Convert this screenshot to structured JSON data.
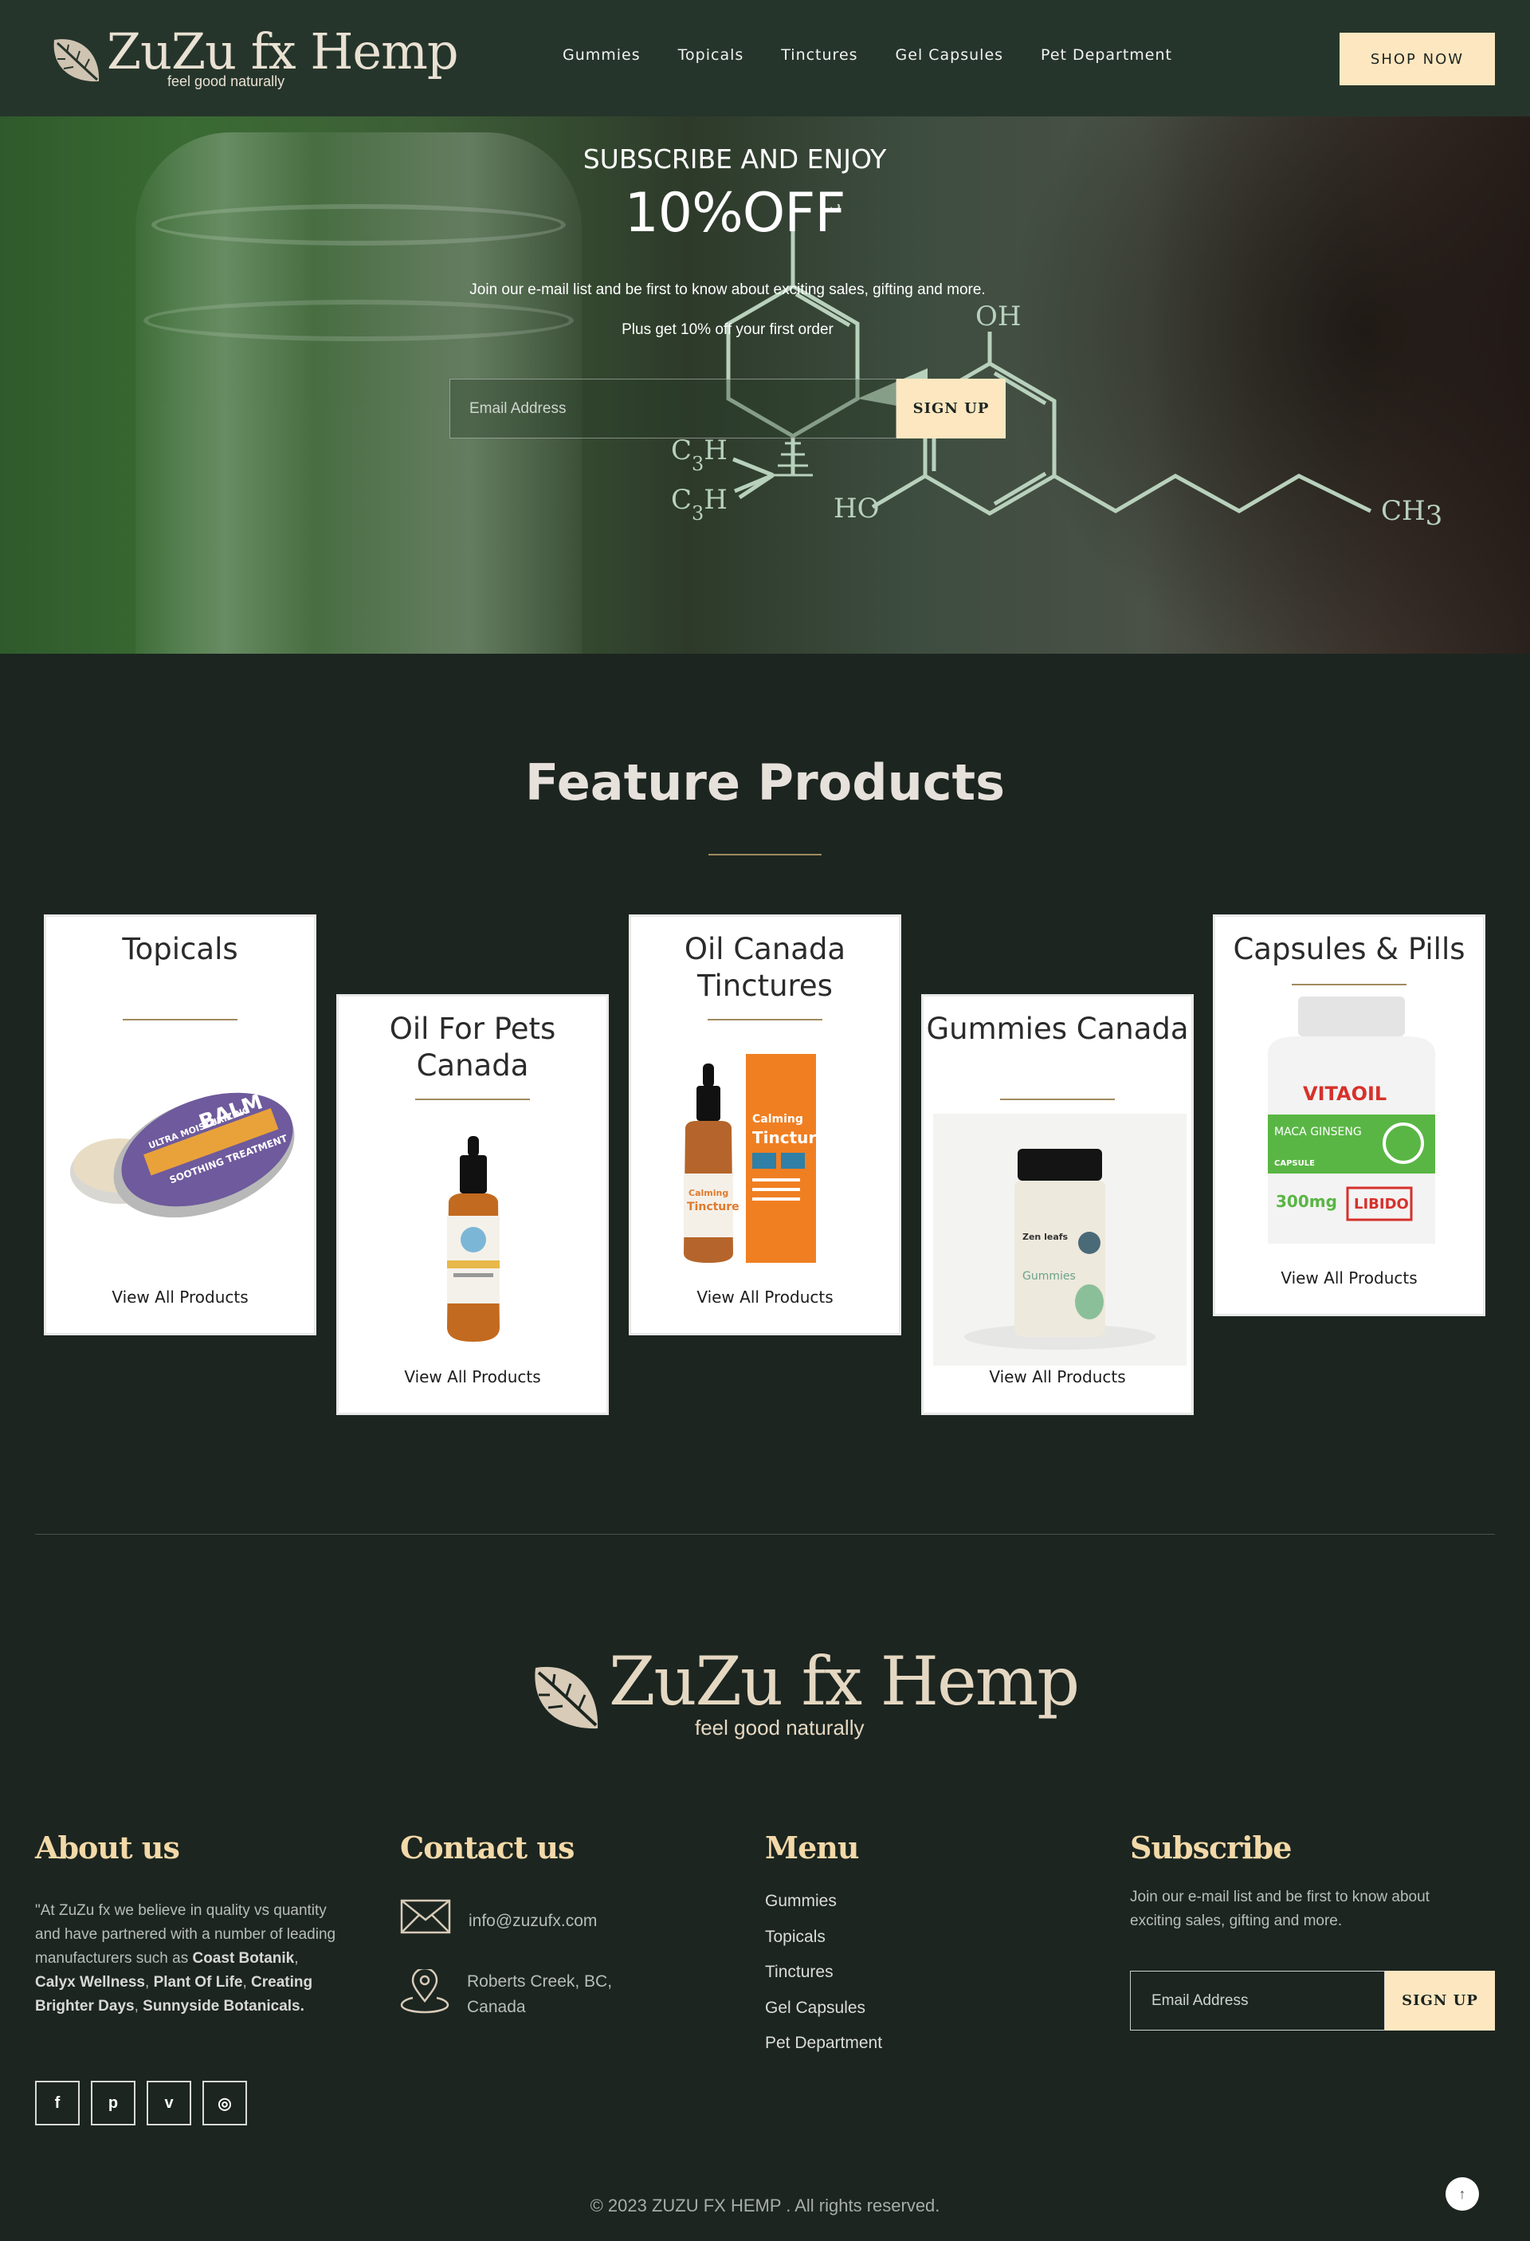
{
  "brand": {
    "name": "ZuZu fx Hemp",
    "tagline": "feel good naturally"
  },
  "nav": {
    "items": [
      "Gummies",
      "Topicals",
      "Tinctures",
      "Gel Capsules",
      "Pet Department"
    ],
    "shop_label": "SHOP NOW"
  },
  "hero": {
    "subtitle": "SUBSCRIBE AND ENJOY",
    "headline": "10%OFF",
    "text1": "Join our e-mail list and be first to know about exciting sales, gifting and more.",
    "text2": "Plus get 10% off your first order",
    "email_placeholder": "Email Address",
    "signup_label": "SIGN UP",
    "molecule_labels": {
      "ch3_top": "CH",
      "ch3_top_sub": "3",
      "oh": "OH",
      "ho": "HO",
      "c3h_a": "C",
      "c3h_a_sub": "3",
      "c3h_a_h": "H",
      "c3h_b": "C",
      "c3h_b_sub": "3",
      "c3h_b_h": "H",
      "ch3_right": "CH",
      "ch3_right_sub": "3"
    }
  },
  "features": {
    "title": "Feature Products",
    "link_label": "View All Products",
    "cards": [
      {
        "title": "Topicals"
      },
      {
        "title": "Oil For Pets Canada"
      },
      {
        "title": "Oil Canada Tinctures"
      },
      {
        "title": "Gummies Canada"
      },
      {
        "title": "Capsules & Pills"
      }
    ],
    "product_labels": {
      "balm_a": "ULTRA MOISTURIZING",
      "balm_b": "BALM",
      "balm_c": "SOOTHING TREATMENT",
      "tincture_a": "Calming",
      "tincture_b": "Tincture",
      "gummies_a": "Zen leafs",
      "gummies_b": "Gummies",
      "caps_a": "VITAOIL",
      "caps_b": "MACA GINSENG",
      "caps_c": "CAPSULE",
      "caps_d": "300mg",
      "caps_e": "LIBIDO"
    }
  },
  "footer": {
    "about": {
      "title": "About us",
      "text_plain1": "\"At ZuZu fx we believe in quality vs quantity and have partnered with a number of leading manufacturers such as ",
      "bold1": "Coast Botanik",
      "sep1": ", ",
      "bold2": "Calyx Wellness",
      "sep2": ", ",
      "bold3": "Plant Of Life",
      "sep3": ", ",
      "bold4": "Creating Brighter Days",
      "sep4": ", ",
      "bold5": "Sunnyside Botanicals",
      "end": "."
    },
    "socials": [
      "f",
      "p",
      "v",
      "◎"
    ],
    "contact": {
      "title": "Contact us",
      "email": "info@zuzufx.com",
      "address1": "Roberts Creek, BC,",
      "address2": "Canada"
    },
    "menu": {
      "title": "Menu",
      "items": [
        "Gummies",
        "Topicals",
        "Tinctures",
        "Gel Capsules",
        "Pet Department"
      ]
    },
    "subscribe": {
      "title": "Subscribe",
      "text": "Join our e-mail list and be first to know about exciting sales, gifting and more.",
      "placeholder": "Email Address",
      "button": "SIGN UP"
    },
    "copyright": "© 2023 ZUZU FX HEMP . All rights reserved.",
    "to_top": "↑"
  },
  "colors": {
    "background": "#1c2520",
    "header": "#26352b",
    "accent": "#fde7c0",
    "gold": "#f3d9a8",
    "rule": "#a08a5f"
  }
}
